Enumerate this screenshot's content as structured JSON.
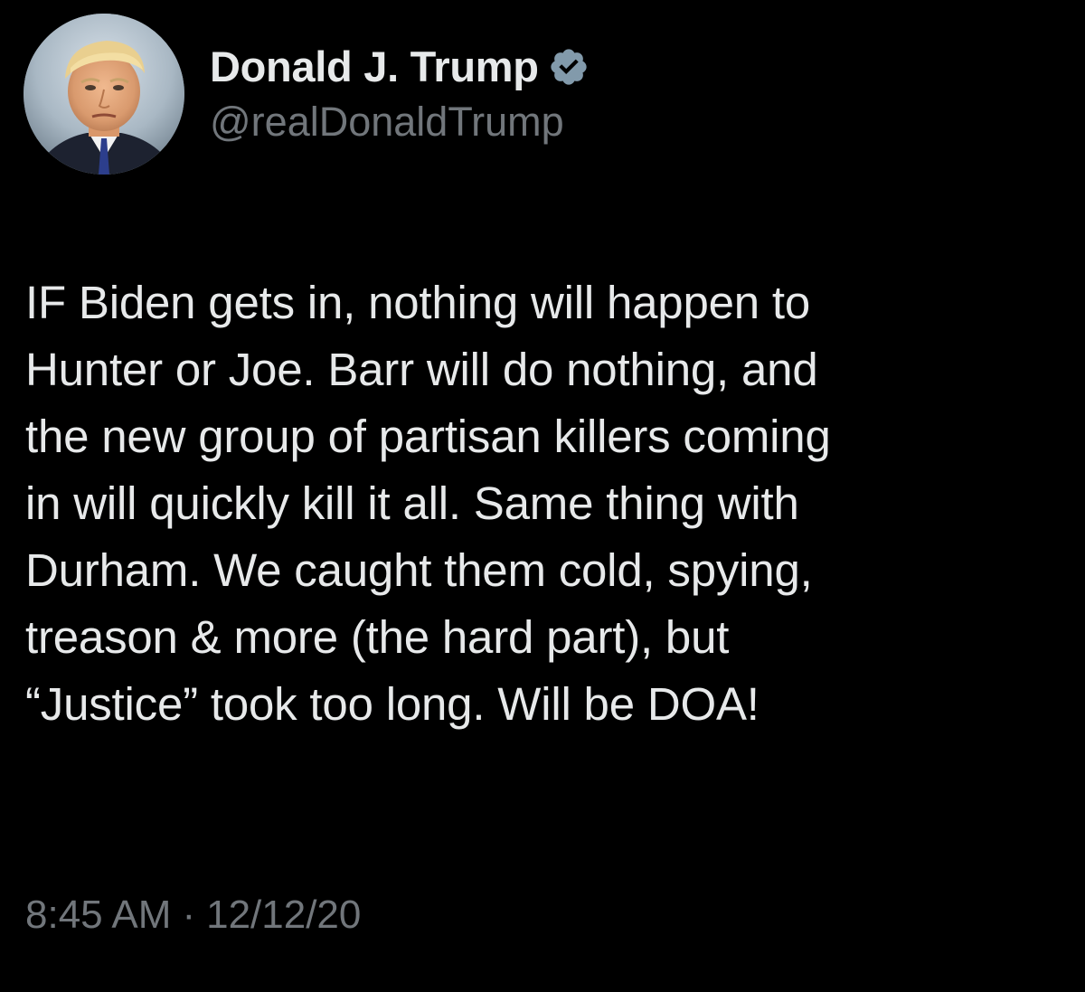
{
  "tweet": {
    "author": {
      "display_name": "Donald J. Trump",
      "handle": "@realDonaldTrump",
      "verified": true,
      "avatar_icon": "profile-photo"
    },
    "text": "IF Biden gets in, nothing will happen to\nHunter or Joe. Barr will do nothing, and\nthe new group of partisan killers coming\nin will quickly kill it all. Same thing with\nDurham. We caught them cold, spying,\ntreason & more (the hard part), but\n“Justice” took too long. Will be DOA!",
    "time": "8:45 AM",
    "separator": "·",
    "date": "12/12/20"
  },
  "colors": {
    "background": "#000000",
    "primary_text": "#e7e9ea",
    "secondary_text": "#71767b",
    "verified_badge": "#829aab"
  }
}
